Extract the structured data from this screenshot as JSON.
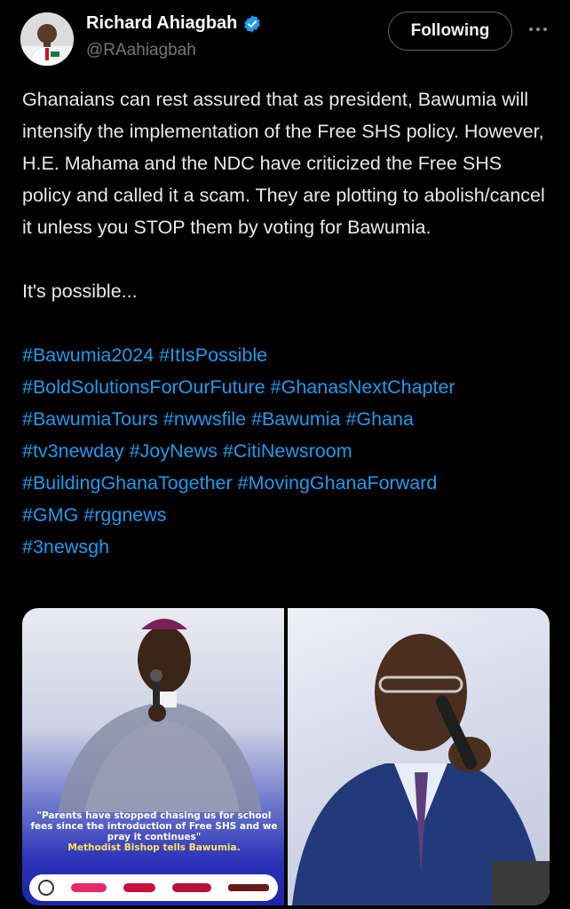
{
  "author": {
    "name": "Richard Ahiagbah",
    "handle": "@RAahiagbah",
    "verified_icon": "verified-badge-icon",
    "verified_color": "#1d9bf0"
  },
  "follow_button": {
    "label": "Following"
  },
  "more_icon": "more-options-icon",
  "tweet": {
    "paragraph1": "Ghanaians can rest assured that as president, Bawumia will intensify the implementation of the Free SHS policy. However, H.E. Mahama and the NDC have criticized the Free SHS policy and called it a scam. They are plotting to abolish/cancel it unless you STOP them by voting for Bawumia.",
    "paragraph2": "It's possible...",
    "hashtags": [
      "#Bawumia2024 #ItIsPossible",
      "#BoldSolutionsForOurFuture #GhanasNextChapter",
      "#BawumiaTours #nwwsfile #Bawumia #Ghana",
      "#tv3newday #JoyNews #CitiNewsroom",
      "#BuildingGhanaTogether #MovingGhanaForward",
      "#GMG #rggnews",
      "#3newsgh"
    ],
    "hashtag_color": "#1d9bf0"
  },
  "media": {
    "left_image": {
      "quote": "\"Parents have stopped chasing us for school fees since the introduction of Free SHS and we pray it continues\"",
      "attribution": "Methodist Bishop tells Bawumia."
    },
    "right_image": {}
  }
}
